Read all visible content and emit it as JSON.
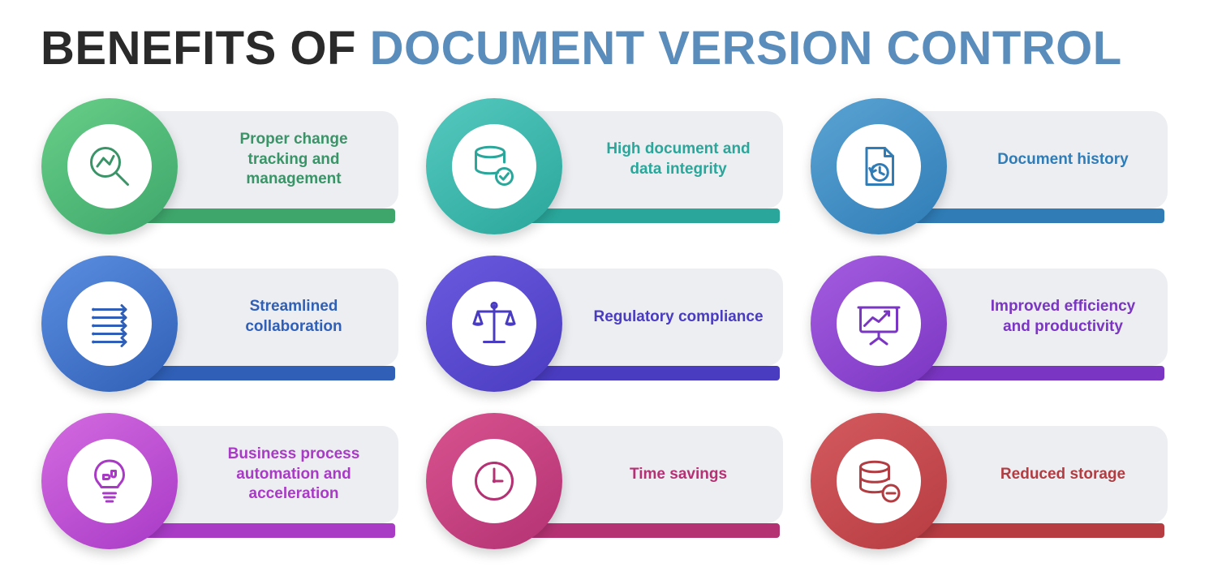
{
  "title": {
    "part1": "Benefits of ",
    "part2": "Document Version Control"
  },
  "colors": {
    "green": {
      "g1": "#67cf87",
      "g2": "#3ea66b",
      "txt": "#3a9468"
    },
    "blue": {
      "g1": "#5b8ee0",
      "g2": "#2f5fb6",
      "txt": "#2f5fb6"
    },
    "magenta": {
      "g1": "#d46be0",
      "g2": "#a83ac6",
      "txt": "#a83ac6"
    },
    "teal": {
      "g1": "#55c9bf",
      "g2": "#2aa69a",
      "txt": "#2aa69a"
    },
    "indigo": {
      "g1": "#6a5adf",
      "g2": "#4a3cc0",
      "txt": "#4a3cc0"
    },
    "pink": {
      "g1": "#d8538f",
      "g2": "#b43273",
      "txt": "#b43273"
    },
    "skyblue": {
      "g1": "#5aa3d3",
      "g2": "#2f7cb6",
      "txt": "#2f7cb6"
    },
    "purple": {
      "g1": "#a45de0",
      "g2": "#7a35c2",
      "txt": "#7a35c2"
    },
    "red": {
      "g1": "#d35a5e",
      "g2": "#b63c42",
      "txt": "#b13c42"
    }
  },
  "items": [
    {
      "label": "Proper change tracking and management",
      "icon": "magnifier-chart-icon",
      "color": "green"
    },
    {
      "label": "High document and data integrity",
      "icon": "database-check-icon",
      "color": "teal"
    },
    {
      "label": "Document history",
      "icon": "document-history-icon",
      "color": "skyblue"
    },
    {
      "label": "Streamlined collaboration",
      "icon": "list-arrows-icon",
      "color": "blue"
    },
    {
      "label": "Regulatory compliance",
      "icon": "scales-icon",
      "color": "indigo"
    },
    {
      "label": "Improved efficiency and productivity",
      "icon": "presentation-chart-icon",
      "color": "purple"
    },
    {
      "label": "Business process automation and acceleration",
      "icon": "lightbulb-puzzle-icon",
      "color": "magenta"
    },
    {
      "label": "Time savings",
      "icon": "clock-icon",
      "color": "pink"
    },
    {
      "label": "Reduced storage",
      "icon": "database-minus-icon",
      "color": "red"
    }
  ]
}
